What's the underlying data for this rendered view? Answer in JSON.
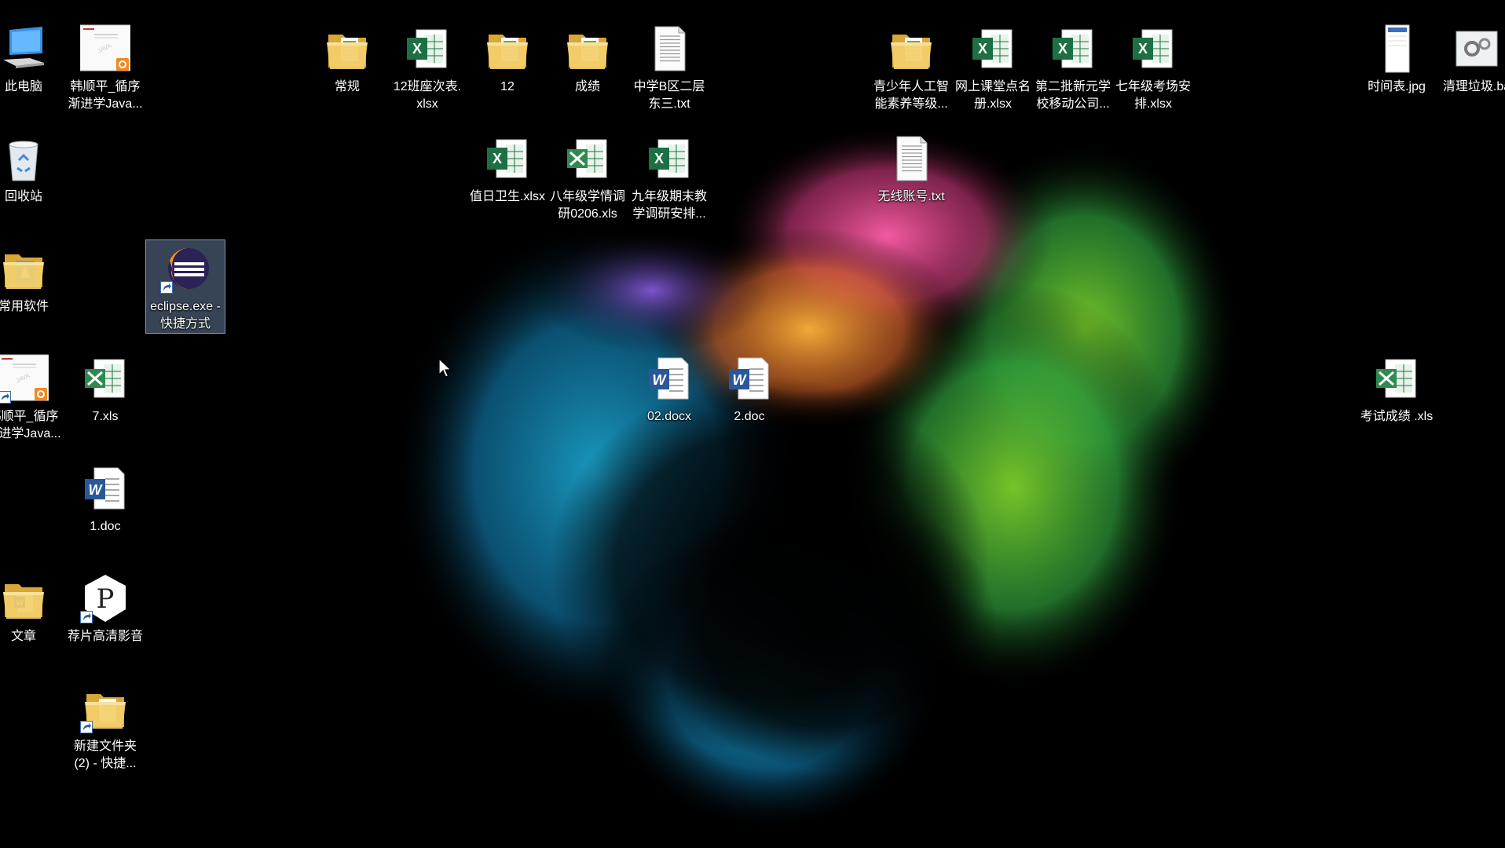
{
  "desktop": {
    "icons": [
      {
        "name": "computer-icon",
        "label": "此电脑",
        "type": "computer"
      },
      {
        "name": "pdf-doc-icon",
        "label": "韩顺平_循序\n渐进学Java...",
        "type": "doc-thumb"
      },
      {
        "name": "folder-icon",
        "label": "常规",
        "type": "folder"
      },
      {
        "name": "excel-icon",
        "label": "12班座次表.\nxlsx",
        "type": "excel"
      },
      {
        "name": "folder-icon",
        "label": "12",
        "type": "folder"
      },
      {
        "name": "folder-icon",
        "label": "成绩",
        "type": "folder"
      },
      {
        "name": "text-file-icon",
        "label": "中学B区二层\n东三.txt",
        "type": "text"
      },
      {
        "name": "folder-icon",
        "label": "青少年人工智\n能素养等级...",
        "type": "folder"
      },
      {
        "name": "excel-icon",
        "label": "网上课堂点名\n册.xlsx",
        "type": "excel"
      },
      {
        "name": "excel-icon",
        "label": "第二批新元学\n校移动公司...",
        "type": "excel"
      },
      {
        "name": "excel-icon",
        "label": "七年级考场安\n排.xlsx",
        "type": "excel"
      },
      {
        "name": "image-file-icon",
        "label": "时间表.jpg",
        "type": "image"
      },
      {
        "name": "batch-file-icon",
        "label": "清理垃圾.ba",
        "type": "batch"
      },
      {
        "name": "recycle-bin-icon",
        "label": "回收站",
        "type": "recycle"
      },
      {
        "name": "excel-icon",
        "label": "值日卫生.xlsx",
        "type": "excel"
      },
      {
        "name": "excel-xls-icon",
        "label": "八年级学情调\n研0206.xls",
        "type": "excel-old"
      },
      {
        "name": "excel-icon",
        "label": "九年级期末教\n学调研安排...",
        "type": "excel"
      },
      {
        "name": "text-file-icon",
        "label": "无线账号.txt",
        "type": "text"
      },
      {
        "name": "folder-icon",
        "label": "常用软件",
        "type": "folder-blue"
      },
      {
        "name": "eclipse-icon",
        "label": "eclipse.exe -\n快捷方式",
        "type": "eclipse"
      },
      {
        "name": "pdf-doc-icon",
        "label": "韩顺平_循序\n渐进学Java...",
        "type": "doc-thumb"
      },
      {
        "name": "excel-xls-icon",
        "label": "7.xls",
        "type": "excel-old"
      },
      {
        "name": "word-icon",
        "label": "02.docx",
        "type": "word"
      },
      {
        "name": "word-icon",
        "label": "2.doc",
        "type": "word"
      },
      {
        "name": "excel-xls-icon",
        "label": "考试成绩 .xls",
        "type": "excel-old"
      },
      {
        "name": "word-icon",
        "label": "1.doc",
        "type": "word"
      },
      {
        "name": "folder-icon",
        "label": "文章",
        "type": "folder-word"
      },
      {
        "name": "player-icon",
        "label": "荐片高清影音",
        "type": "player"
      },
      {
        "name": "folder-icon",
        "label": "新建文件夹\n(2) - 快捷...",
        "type": "folder-shortcut"
      }
    ]
  }
}
